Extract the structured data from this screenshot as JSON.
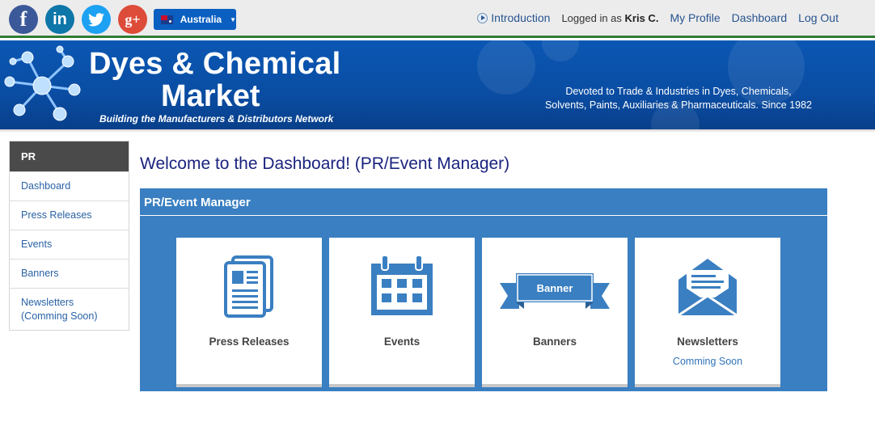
{
  "topbar": {
    "social": [
      {
        "glyph": "f",
        "icon": "facebook-icon"
      },
      {
        "glyph": "in",
        "icon": "linkedin-icon"
      },
      {
        "glyph": "",
        "icon": "twitter-icon"
      },
      {
        "glyph": "g+",
        "icon": "google-plus-icon"
      }
    ],
    "country": "Australia",
    "introduction": "Introduction",
    "logged_in_prefix": "Logged in as",
    "user_name": "Kris C.",
    "my_profile": "My Profile",
    "dashboard": "Dashboard",
    "logout": "Log Out"
  },
  "banner": {
    "brand_line1": "Dyes & Chemical",
    "brand_line2": "Market",
    "tagline": "Building the Manufacturers & Distributors Network",
    "devoted_line1": "Devoted to Trade & Industries in Dyes, Chemicals,",
    "devoted_line2": "Solvents, Paints, Auxiliaries & Pharmaceuticals. Since 1982"
  },
  "sidebar": {
    "header": "PR",
    "items": [
      {
        "label": "Dashboard"
      },
      {
        "label": "Press Releases"
      },
      {
        "label": "Events"
      },
      {
        "label": "Banners"
      },
      {
        "label": "Newsletters",
        "label2": "(Comming Soon)"
      }
    ]
  },
  "main": {
    "welcome": "Welcome to the Dashboard! (PR/Event Manager)",
    "panel_title": "PR/Event Manager",
    "cards": [
      {
        "label": "Press Releases",
        "icon": "press-release-icon"
      },
      {
        "label": "Events",
        "icon": "calendar-icon"
      },
      {
        "label": "Banners",
        "icon": "banner-icon",
        "banner_text": "Banner"
      },
      {
        "label": "Newsletters",
        "icon": "newsletter-icon",
        "sub": "Comming Soon"
      }
    ]
  },
  "colors": {
    "accent": "#3a7fc1",
    "link": "#2a62a6",
    "banner_blue": "#0b57b3",
    "title": "#1a237e"
  }
}
